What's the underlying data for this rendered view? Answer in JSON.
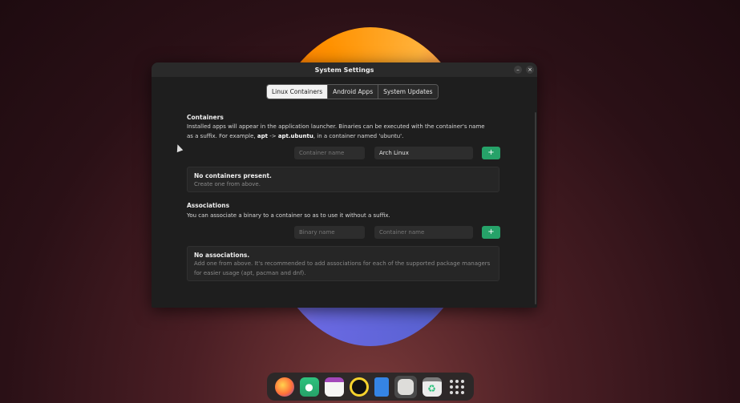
{
  "window": {
    "title": "System Settings",
    "minimize_label": "–",
    "close_label": "×"
  },
  "tabs": [
    {
      "label": "Linux Containers",
      "active": true
    },
    {
      "label": "Android Apps",
      "active": false
    },
    {
      "label": "System Updates",
      "active": false
    }
  ],
  "containers": {
    "title": "Containers",
    "desc_part1": "Installed apps will appear in the application launcher. Binaries can be executed with the container's name as a suffix. For example, ",
    "desc_bold1": "apt",
    "desc_arrow": " -> ",
    "desc_bold2": "apt.ubuntu",
    "desc_part2": ", in a container named 'ubuntu'.",
    "name_placeholder": "Container name",
    "distro_value": "Arch Linux",
    "add_label": "+",
    "empty_title": "No containers present.",
    "empty_sub": "Create one from above."
  },
  "associations": {
    "title": "Associations",
    "desc": "You can associate a binary to a container so as to use it without a suffix.",
    "binary_placeholder": "Binary name",
    "container_placeholder": "Container name",
    "add_label": "+",
    "empty_title": "No associations.",
    "empty_sub": "Add one from above. It's recommended to add associations for each of the supported package managers for easier usage (apt, pacman and dnf)."
  },
  "dock": {
    "items": [
      "firefox-icon",
      "software-store-icon",
      "calendar-icon",
      "music-player-icon",
      "notes-icon",
      "settings-app-icon",
      "recycle-bin-icon",
      "app-grid-icon"
    ]
  },
  "colors": {
    "accent": "#26a269",
    "window_bg": "#1e1e1e",
    "titlebar_bg": "#2a2a2a"
  }
}
